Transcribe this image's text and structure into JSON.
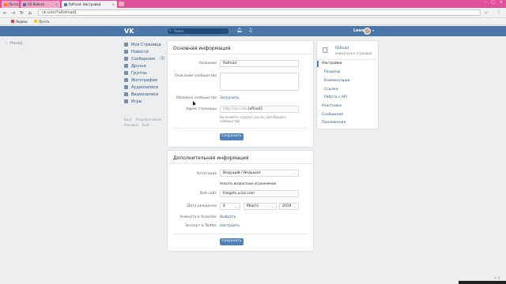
{
  "browser": {
    "tabs": [
      {
        "label": "Почта",
        "active": false,
        "favicon": "mail-icon"
      },
      {
        "label": "US Bullock",
        "active": false,
        "favicon": "vk-icon"
      },
      {
        "label": "Rafinad: Настройки",
        "active": true,
        "favicon": "vk-icon"
      }
    ],
    "url": "vk.com/?ixRafinad1",
    "bookmarks": [
      {
        "label": "Яндекс",
        "icon": "yandex-icon"
      },
      {
        "label": "Почта",
        "icon": "mail-icon"
      }
    ]
  },
  "header": {
    "logo": "VK",
    "search_placeholder": "Поиск",
    "user_name": "Leon"
  },
  "back_link": "Назад",
  "left_menu": [
    {
      "label": "Моя Страница",
      "icon": "home-icon"
    },
    {
      "label": "Новости",
      "icon": "news-icon"
    },
    {
      "label": "Сообщения",
      "icon": "message-icon",
      "badge": "1"
    },
    {
      "label": "Друзья",
      "icon": "friends-icon"
    },
    {
      "label": "Группы",
      "icon": "groups-icon"
    },
    {
      "label": "Фотографии",
      "icon": "photo-icon"
    },
    {
      "label": "Аудиозаписи",
      "icon": "audio-icon"
    },
    {
      "label": "Видеозаписи",
      "icon": "video-icon"
    },
    {
      "label": "Игры",
      "icon": "games-icon"
    }
  ],
  "footer_links": [
    "Блог",
    "Разработчикам",
    "Реклама",
    "Ещё"
  ],
  "basic": {
    "title": "Основная информация",
    "name_label": "Название",
    "name_value": "Rafinad",
    "desc_label": "Описание сообщества",
    "desc_value": "",
    "cover_label": "Обложка сообщества",
    "cover_action": "Загрузить",
    "address_label": "Адрес страницы",
    "address_prefix": "http://vk.com/",
    "address_value": "rafinad1",
    "address_hint": "Вы можете создать ссылку для Вашего сообщества.",
    "save_label": "Сохранить"
  },
  "extra": {
    "title": "Дополнительная информация",
    "category_label": "Категория",
    "category_value": "Ведущий / Ведущая",
    "age_limit_link": "Указать возрастные ограничения",
    "site_label": "Веб-сайт",
    "site_value": "frolgets.ucoz.com",
    "date_label": "Дата рождения",
    "day": "4",
    "month": "Марта",
    "year": "2019",
    "snapster_label": "Комната в Snapster",
    "snapster_action": "Выбрать",
    "twitter_label": "Экспорт в Twitter",
    "twitter_action": "Настроить",
    "save_label": "Сохранить"
  },
  "right_menu": {
    "group_name": "Rafinad",
    "group_sub": "вернуться к странице",
    "items": [
      {
        "label": "Настройки",
        "active": true,
        "sub": false
      },
      {
        "label": "Разделы",
        "active": false,
        "sub": true
      },
      {
        "label": "Комментарии",
        "active": false,
        "sub": true
      },
      {
        "label": "Ссылки",
        "active": false,
        "sub": true
      },
      {
        "label": "Работа с API",
        "active": false,
        "sub": true
      },
      {
        "label": "Участники",
        "active": false,
        "sub": false
      },
      {
        "label": "Сообщения",
        "active": false,
        "sub": false
      },
      {
        "label": "Приложения",
        "active": false,
        "sub": false
      }
    ]
  },
  "zoom": "+ 3",
  "colors": {
    "vk_blue": "#4a76a8",
    "button": "#5181b8",
    "tabbar": "#e0509b",
    "link": "#2a5885"
  }
}
